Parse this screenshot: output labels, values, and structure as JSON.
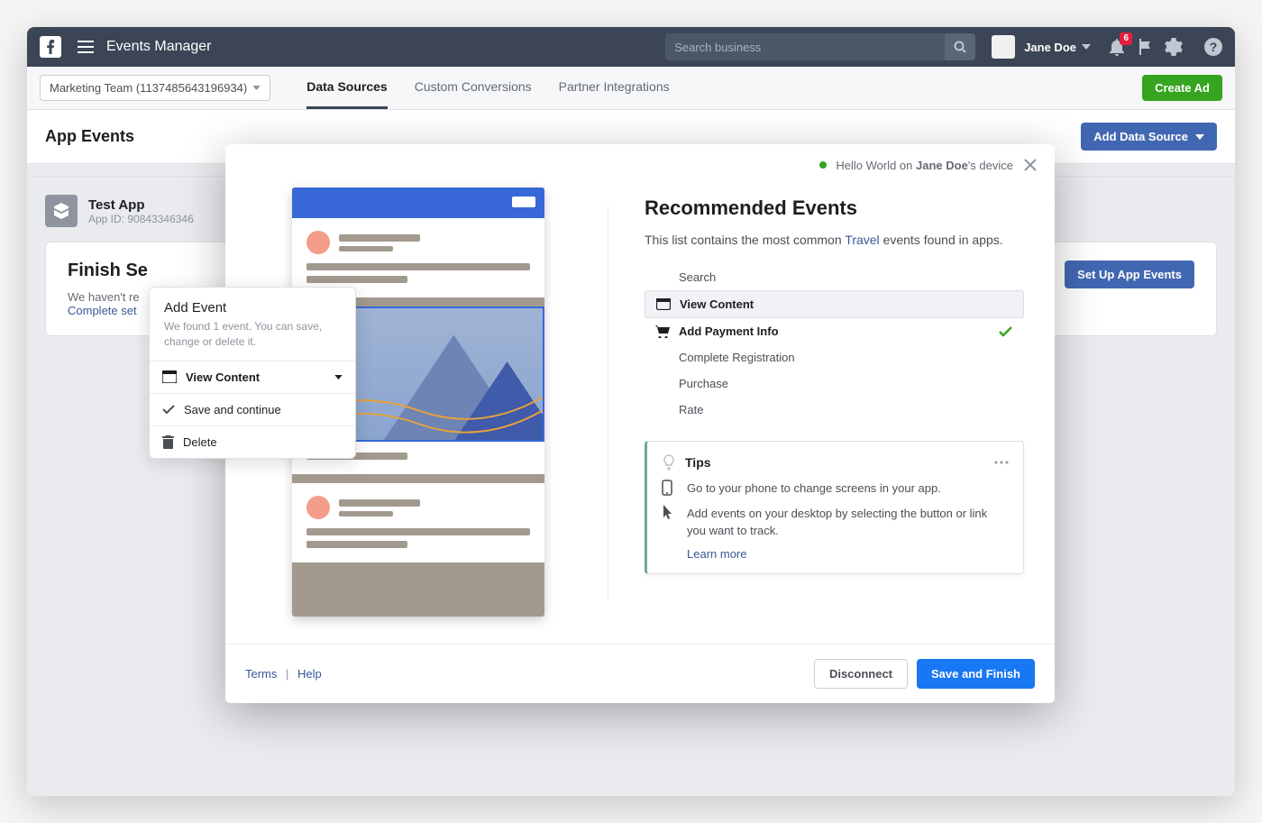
{
  "header": {
    "title": "Events Manager",
    "search_placeholder": "Search business",
    "username": "Jane Doe",
    "notification_count": "6"
  },
  "subnav": {
    "team_dropdown": "Marketing Team (1137485643196934)",
    "tabs": [
      "Data Sources",
      "Custom Conversions",
      "Partner Integrations"
    ],
    "create_ad": "Create Ad"
  },
  "section": {
    "title": "App Events",
    "add_ds": "Add Data Source"
  },
  "app": {
    "name": "Test App",
    "id_label": "App ID: 90843346346"
  },
  "card": {
    "title": "Finish Se",
    "sub_prefix": "We haven't re",
    "link": "Complete set",
    "button": "Set Up App Events"
  },
  "popover": {
    "title": "Add Event",
    "desc": "We found 1 event. You can save, change or delete it.",
    "item_content": "View Content",
    "save": "Save and continue",
    "delete": "Delete"
  },
  "modal": {
    "status_prefix": "Hello World on ",
    "status_name": "Jane Doe",
    "status_suffix": "'s device",
    "rec_title": "Recommended Events",
    "rec_desc_prefix": "This list contains the most common ",
    "rec_desc_link": "Travel",
    "rec_desc_suffix": " events found in apps.",
    "events": {
      "search": "Search",
      "view_content": "View Content",
      "add_payment": "Add Payment Info",
      "complete_reg": "Complete Registration",
      "purchase": "Purchase",
      "rate": "Rate"
    },
    "tips": {
      "title": "Tips",
      "tip1": "Go to your phone to change screens in your app.",
      "tip2": "Add events on your desktop by selecting the button or link you want to track.",
      "learn_more": "Learn more"
    },
    "footer": {
      "terms": "Terms",
      "help": "Help",
      "disconnect": "Disconnect",
      "save_finish": "Save and Finish"
    }
  }
}
